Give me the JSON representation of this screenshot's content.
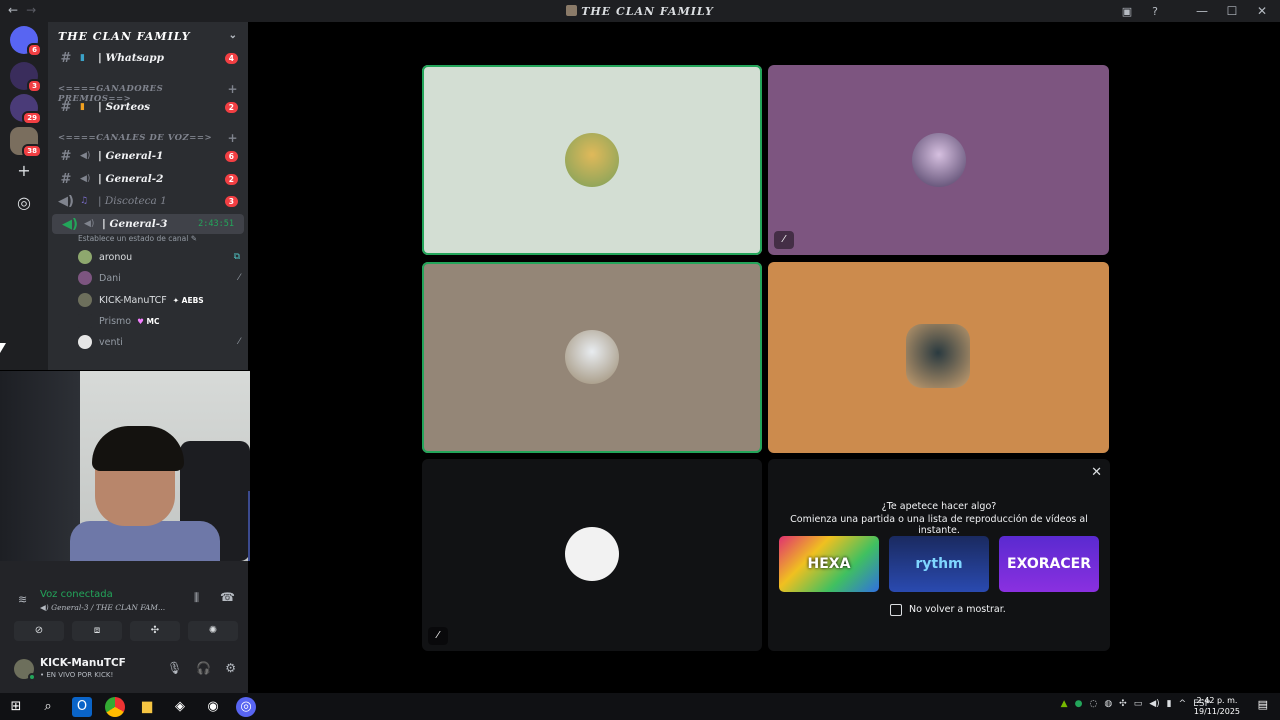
{
  "window": {
    "title": "THE CLAN FAMILY"
  },
  "servers": {
    "badges": [
      "6",
      "3",
      "29",
      "38"
    ]
  },
  "sidebar": {
    "server_name": "THE CLAN FAMILY",
    "channels": [
      {
        "name": "| Whatsapp",
        "count": "4"
      },
      {
        "name": "| Sorteos",
        "count": "2"
      },
      {
        "name": "| General-1",
        "count": "6"
      },
      {
        "name": "| General-2",
        "count": "2"
      },
      {
        "name": "| Discoteca 1",
        "count": "3"
      },
      {
        "name": "| General-3",
        "timer": "2:43:51"
      }
    ],
    "categories": [
      "<====GANADORES PREMIOS==>",
      "<====CANALES DE VOZ==>"
    ],
    "channel_status_placeholder": "Establece un estado de canal",
    "members": [
      {
        "name": "aronou"
      },
      {
        "name": "Dani"
      },
      {
        "name": "KICK-ManuTCF",
        "tag": "AEBS"
      },
      {
        "name": "Prismo",
        "tag": "MC"
      },
      {
        "name": "venti"
      }
    ]
  },
  "voice": {
    "status": "Voz conectada",
    "channel": "General-3 / THE CLAN FAM..."
  },
  "user": {
    "name": "KICK-ManuTCF",
    "status": "• EN VIVO POR KICK!"
  },
  "activity": {
    "question": "¿Te apetece hacer algo?",
    "subtitle": "Comienza una partida o una lista de reproducción de vídeos al instante.",
    "games": [
      "HEXA",
      "rythm",
      "EXORACER"
    ],
    "dont_show": "No volver a mostrar."
  },
  "taskbar": {
    "language": "ESP",
    "time": "2:42 p. m.",
    "date": "19/11/2025"
  },
  "colors": {
    "speaking": "#23a55a",
    "tile1": "#d3ded3",
    "tile2": "#7d5580",
    "tile3": "#948677",
    "tile4": "#cc8b4d"
  }
}
